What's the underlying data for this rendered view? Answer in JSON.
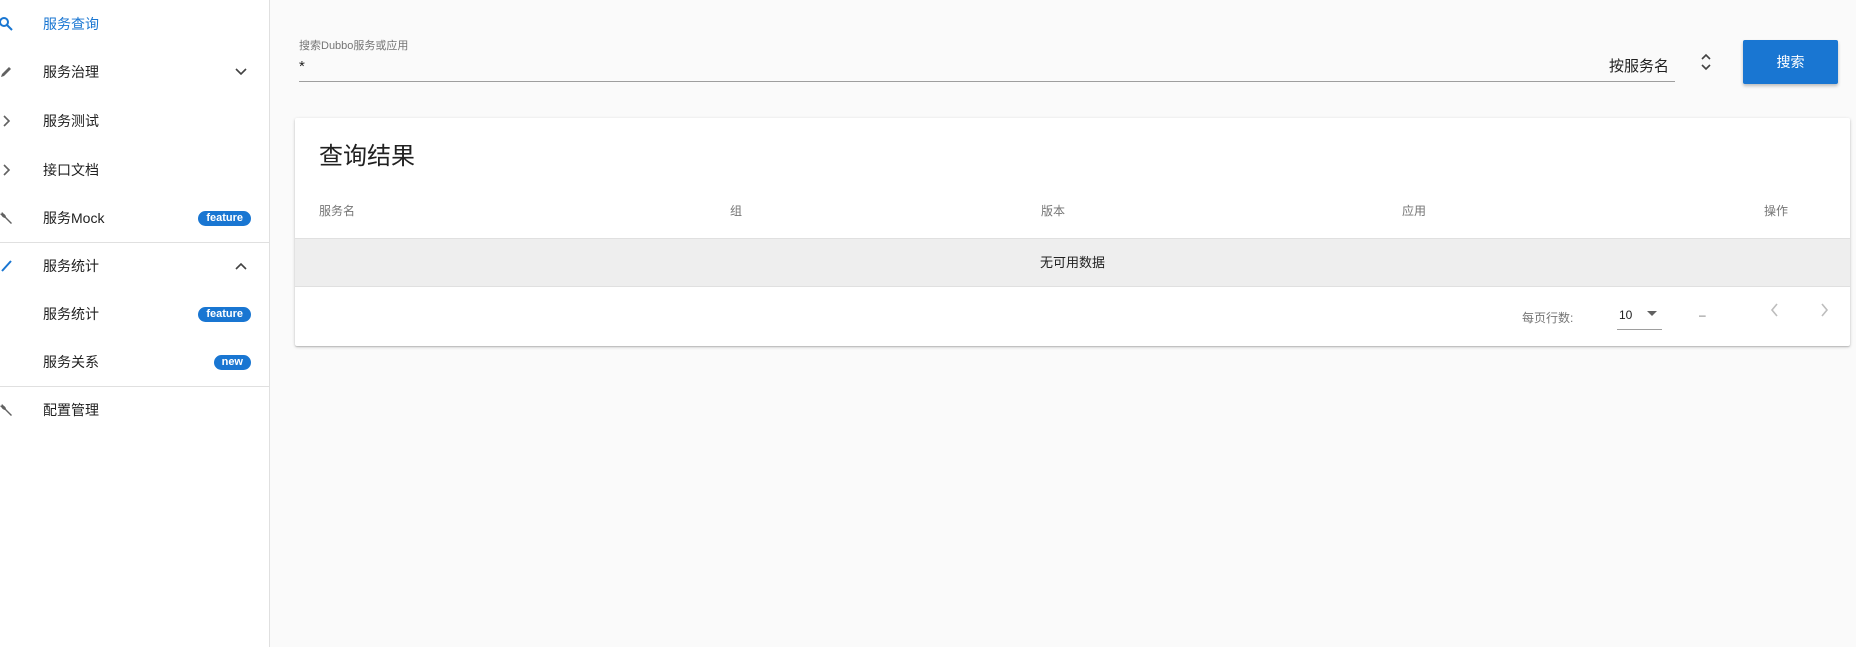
{
  "sidebar": {
    "items": [
      {
        "label": "服务查询",
        "icon": "search-icon",
        "active": true
      },
      {
        "label": "服务治理",
        "icon": "edit-icon",
        "chevron": "down"
      },
      {
        "label": "服务测试",
        "icon": "chevron-right-icon"
      },
      {
        "label": "接口文档",
        "icon": "chevron-right-icon"
      },
      {
        "label": "服务Mock",
        "icon": "wrench-icon",
        "badge": "feature"
      },
      {
        "label": "服务统计",
        "icon": "check-icon",
        "chevron": "up"
      },
      {
        "label": "服务统计",
        "badge": "feature"
      },
      {
        "label": "服务关系",
        "badge": "new"
      },
      {
        "label": "配置管理",
        "icon": "wrench-icon"
      }
    ]
  },
  "search": {
    "label": "搜索Dubbo服务或应用",
    "value": "*",
    "mode": "按服务名",
    "button": "搜索"
  },
  "results": {
    "title": "查询结果",
    "columns": [
      "服务名",
      "组",
      "版本",
      "应用",
      "操作"
    ],
    "empty_text": "无可用数据",
    "rows_per_page_label": "每页行数:",
    "rows_per_page": "10",
    "range": "–"
  },
  "colors": {
    "accent": "#1976d2",
    "background": "#fafafa",
    "empty_row": "#eeeeee"
  }
}
